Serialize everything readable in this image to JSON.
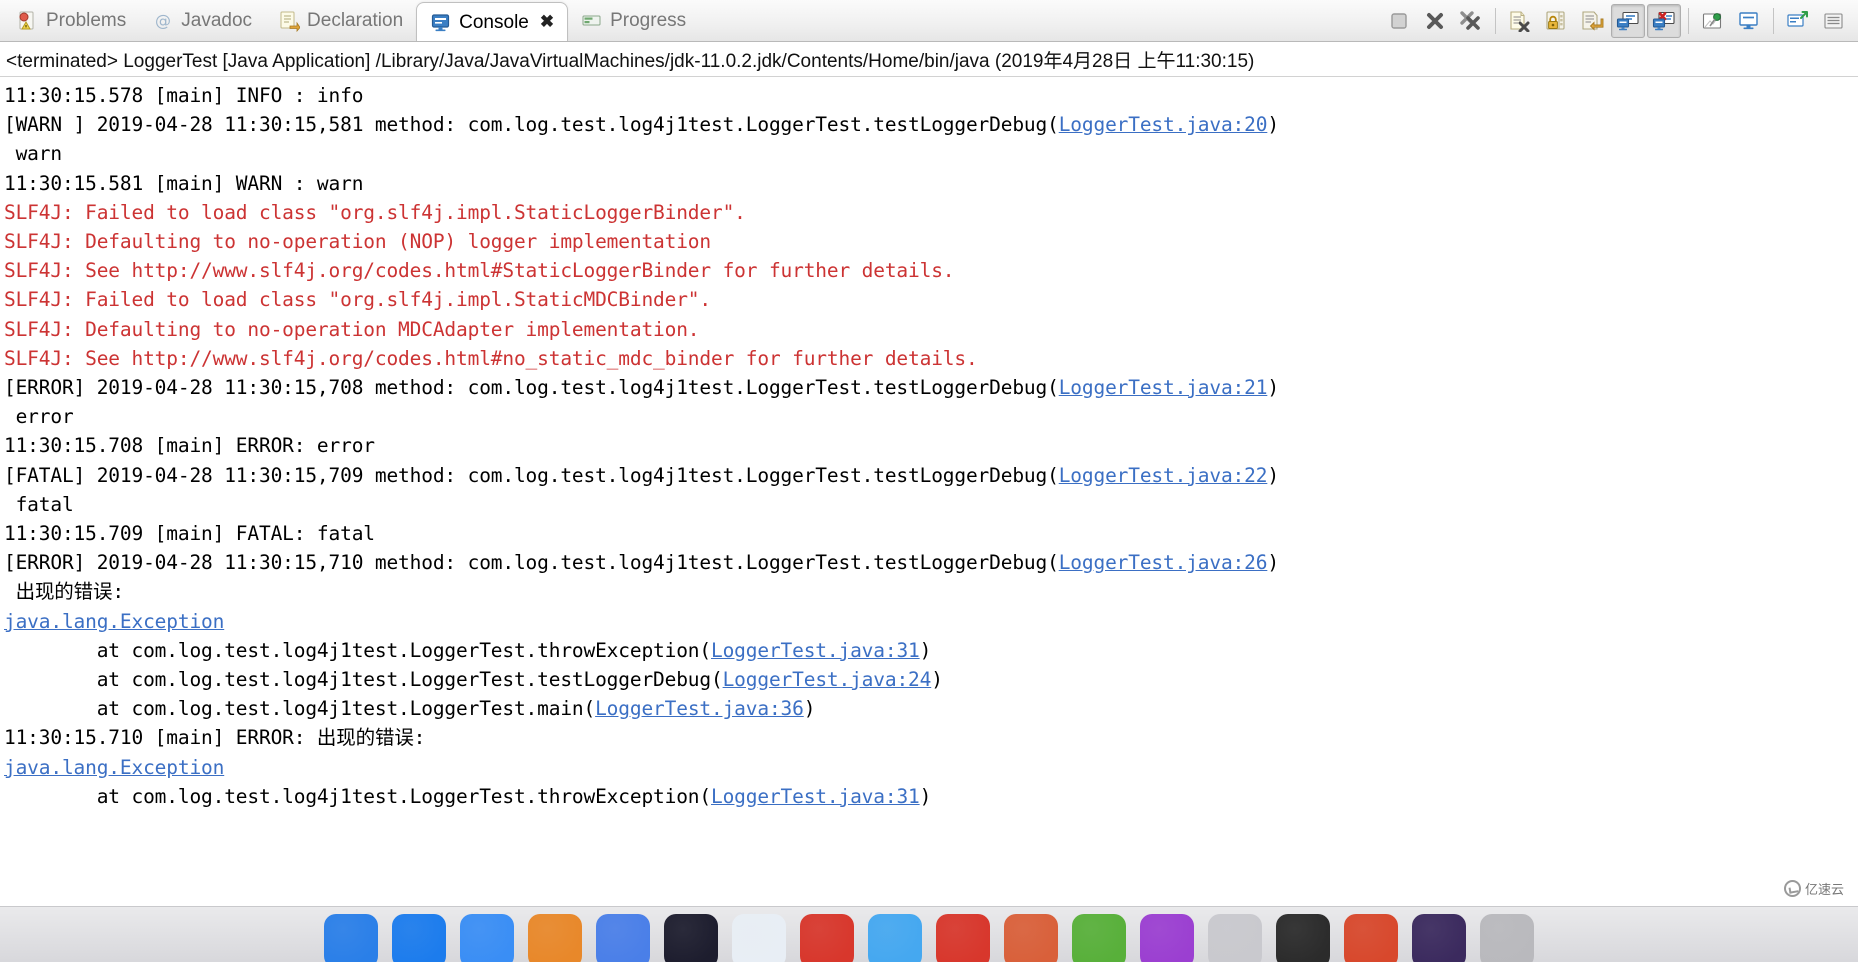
{
  "tabs": [
    {
      "label": "Problems",
      "icon": "problems-icon",
      "active": false
    },
    {
      "label": "Javadoc",
      "icon": "javadoc-icon",
      "active": false
    },
    {
      "label": "Declaration",
      "icon": "declaration-icon",
      "active": false
    },
    {
      "label": "Console",
      "icon": "console-icon",
      "active": true,
      "close_glyph": "✖"
    }
  ],
  "toolbar": {
    "buttons": [
      {
        "name": "terminate-button",
        "icon": "stop-square-icon",
        "pressed": false
      },
      {
        "name": "remove-launch-button",
        "icon": "x-mark-icon",
        "pressed": false
      },
      {
        "name": "remove-all-terminated-button",
        "icon": "double-x-mark-icon",
        "pressed": false
      },
      {
        "name": "clear-console-button",
        "icon": "document-x-icon",
        "pressed": false
      },
      {
        "name": "scroll-lock-button",
        "icon": "lock-icon",
        "pressed": false
      },
      {
        "name": "word-wrap-button",
        "icon": "document-wrap-icon",
        "pressed": false
      },
      {
        "name": "show-console-on-output-button",
        "icon": "console-output-icon",
        "pressed": true
      },
      {
        "name": "show-console-on-error-button",
        "icon": "console-error-icon",
        "pressed": true
      },
      {
        "name": "pin-console-button",
        "icon": "pin-icon",
        "pressed": false
      },
      {
        "name": "display-selected-console-button",
        "icon": "display-icon",
        "pressed": false
      },
      {
        "name": "open-console-button",
        "icon": "open-console-icon",
        "pressed": false
      },
      {
        "name": "view-menu-button",
        "icon": "view-menu-icon",
        "pressed": false
      }
    ]
  },
  "process": {
    "status_line": "<terminated> LoggerTest [Java Application] /Library/Java/JavaVirtualMachines/jdk-11.0.2.jdk/Contents/Home/bin/java (2019年4月28日 上午11:30:15)"
  },
  "console": {
    "lines": [
      {
        "type": "plain",
        "text": "11:30:15.578 [main] INFO : info"
      },
      {
        "type": "link",
        "pre": "[WARN ] 2019-04-28 11:30:15,581 method: com.log.test.log4j1test.LoggerTest.testLoggerDebug(",
        "link": "LoggerTest.java:20",
        "post": ")"
      },
      {
        "type": "plain",
        "text": " warn"
      },
      {
        "type": "plain",
        "text": "11:30:15.581 [main] WARN : warn"
      },
      {
        "type": "error",
        "text": "SLF4J: Failed to load class \"org.slf4j.impl.StaticLoggerBinder\"."
      },
      {
        "type": "error",
        "text": "SLF4J: Defaulting to no-operation (NOP) logger implementation"
      },
      {
        "type": "error",
        "text": "SLF4J: See http://www.slf4j.org/codes.html#StaticLoggerBinder for further details."
      },
      {
        "type": "error",
        "text": "SLF4J: Failed to load class \"org.slf4j.impl.StaticMDCBinder\"."
      },
      {
        "type": "error",
        "text": "SLF4J: Defaulting to no-operation MDCAdapter implementation."
      },
      {
        "type": "error",
        "text": "SLF4J: See http://www.slf4j.org/codes.html#no_static_mdc_binder for further details."
      },
      {
        "type": "link",
        "pre": "[ERROR] 2019-04-28 11:30:15,708 method: com.log.test.log4j1test.LoggerTest.testLoggerDebug(",
        "link": "LoggerTest.java:21",
        "post": ")"
      },
      {
        "type": "plain",
        "text": " error"
      },
      {
        "type": "plain",
        "text": "11:30:15.708 [main] ERROR: error"
      },
      {
        "type": "link",
        "pre": "[FATAL] 2019-04-28 11:30:15,709 method: com.log.test.log4j1test.LoggerTest.testLoggerDebug(",
        "link": "LoggerTest.java:22",
        "post": ")"
      },
      {
        "type": "plain",
        "text": " fatal"
      },
      {
        "type": "plain",
        "text": "11:30:15.709 [main] FATAL: fatal"
      },
      {
        "type": "link",
        "pre": "[ERROR] 2019-04-28 11:30:15,710 method: com.log.test.log4j1test.LoggerTest.testLoggerDebug(",
        "link": "LoggerTest.java:26",
        "post": ")"
      },
      {
        "type": "plain",
        "text": " 出现的错误:"
      },
      {
        "type": "link",
        "pre": "",
        "link": "java.lang.Exception",
        "post": ""
      },
      {
        "type": "link",
        "pre": "        at com.log.test.log4j1test.LoggerTest.throwException(",
        "link": "LoggerTest.java:31",
        "post": ")"
      },
      {
        "type": "link",
        "pre": "        at com.log.test.log4j1test.LoggerTest.testLoggerDebug(",
        "link": "LoggerTest.java:24",
        "post": ")"
      },
      {
        "type": "link",
        "pre": "        at com.log.test.log4j1test.LoggerTest.main(",
        "link": "LoggerTest.java:36",
        "post": ")"
      },
      {
        "type": "plain",
        "text": "11:30:15.710 [main] ERROR: 出现的错误:"
      },
      {
        "type": "link",
        "pre": "",
        "link": "java.lang.Exception",
        "post": ""
      },
      {
        "type": "link",
        "pre": "        at com.log.test.log4j1test.LoggerTest.throwException(",
        "link": "LoggerTest.java:31",
        "post": ")"
      }
    ]
  },
  "dock": {
    "icons": [
      {
        "name": "finder",
        "color": "#2a7fe8"
      },
      {
        "name": "safari",
        "color": "#1c7ced"
      },
      {
        "name": "mail",
        "color": "#3a8ef5"
      },
      {
        "name": "contacts",
        "color": "#e8882a"
      },
      {
        "name": "calendar",
        "color": "#4a7fe8"
      },
      {
        "name": "notes",
        "color": "#1d1d2e"
      },
      {
        "name": "reminders",
        "color": "#e8eef5"
      },
      {
        "name": "photos",
        "color": "#d8372c"
      },
      {
        "name": "messages",
        "color": "#45a8f0"
      },
      {
        "name": "facetime",
        "color": "#d8372c"
      },
      {
        "name": "itunes",
        "color": "#d9603a"
      },
      {
        "name": "appstore",
        "color": "#58b03a"
      },
      {
        "name": "launchpad",
        "color": "#9b3fd1"
      },
      {
        "name": "preferences",
        "color": "#c9c9ce"
      },
      {
        "name": "terminal",
        "color": "#2b2b2b"
      },
      {
        "name": "chrome",
        "color": "#d8482c"
      },
      {
        "name": "eclipse",
        "color": "#3b2a5e"
      },
      {
        "name": "trash",
        "color": "#b9b9bd"
      }
    ]
  },
  "colors": {
    "error_red": "#cc3333",
    "link_blue": "#3b6fc4",
    "tab_inactive": "#777777",
    "tab_active": "#000000"
  },
  "watermark": {
    "text": "亿速云"
  }
}
